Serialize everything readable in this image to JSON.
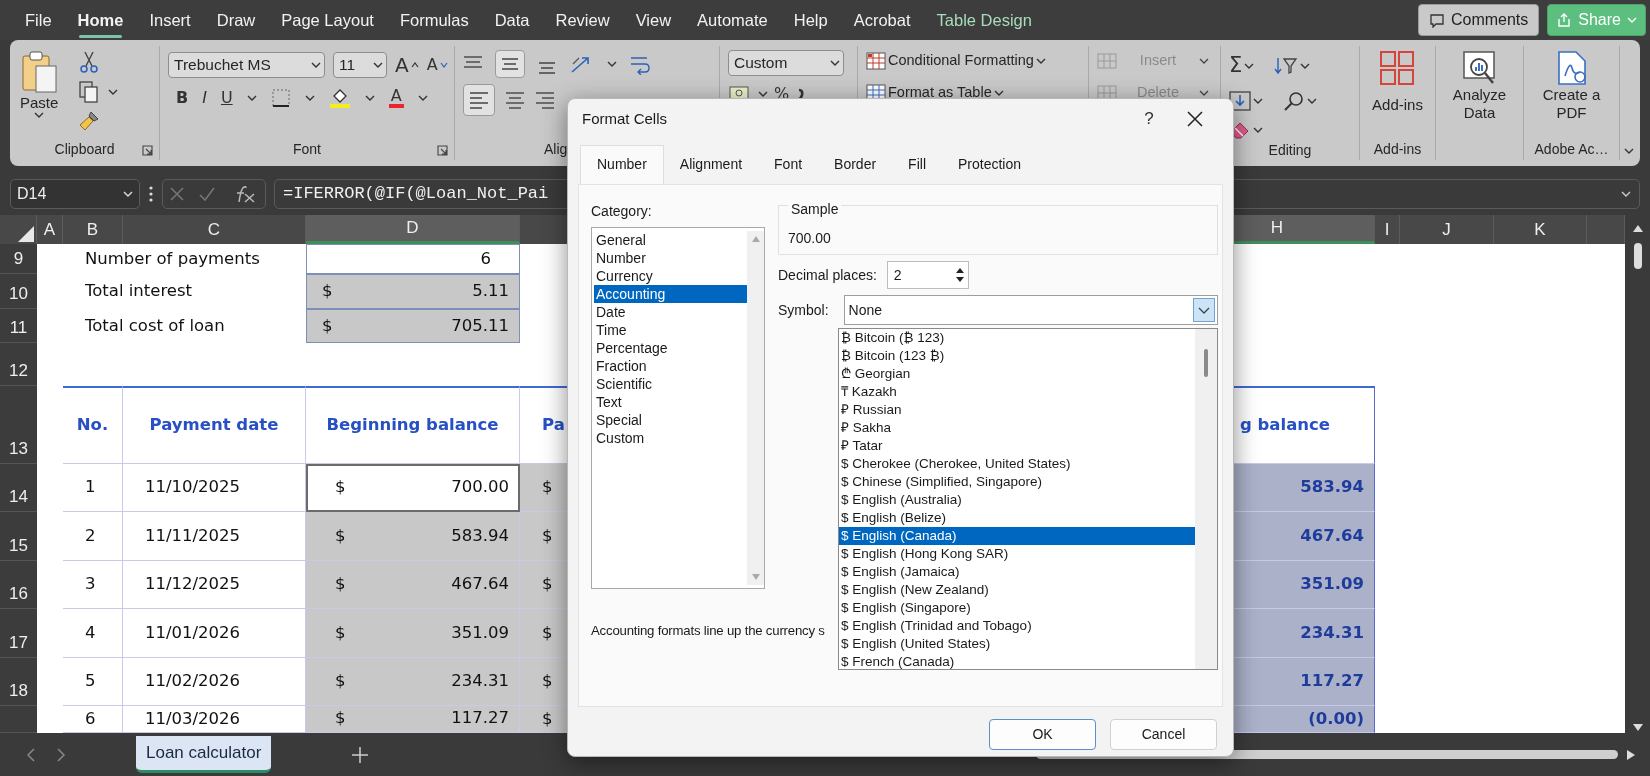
{
  "menu_tabs": [
    {
      "label": "File",
      "selected": false,
      "kind": "standard"
    },
    {
      "label": "Home",
      "selected": true,
      "kind": "standard"
    },
    {
      "label": "Insert",
      "selected": false,
      "kind": "standard"
    },
    {
      "label": "Draw",
      "selected": false,
      "kind": "standard"
    },
    {
      "label": "Page Layout",
      "selected": false,
      "kind": "standard"
    },
    {
      "label": "Formulas",
      "selected": false,
      "kind": "standard"
    },
    {
      "label": "Data",
      "selected": false,
      "kind": "standard"
    },
    {
      "label": "Review",
      "selected": false,
      "kind": "standard"
    },
    {
      "label": "View",
      "selected": false,
      "kind": "standard"
    },
    {
      "label": "Automate",
      "selected": false,
      "kind": "standard"
    },
    {
      "label": "Help",
      "selected": false,
      "kind": "standard"
    },
    {
      "label": "Acrobat",
      "selected": false,
      "kind": "standard"
    },
    {
      "label": "Table Design",
      "selected": false,
      "kind": "contextual"
    }
  ],
  "title_actions": {
    "comments": "Comments",
    "share": "Share"
  },
  "ribbon": {
    "clipboard": {
      "paste": "Paste",
      "label": "Clipboard"
    },
    "font": {
      "font_name": "Trebuchet MS",
      "font_size": "11",
      "grow": "A",
      "shrink": "A",
      "bold": "B",
      "italic": "I",
      "underline": "U",
      "font_color": "A",
      "label": "Font"
    },
    "alignment": {
      "label": "Alig"
    },
    "number": {
      "format": "Custom",
      "percent": "%"
    },
    "styles": {
      "conditional": "Conditional Formatting",
      "format_table": "Format as Table"
    },
    "cells": [
      {
        "label": "Insert",
        "disabled": true
      },
      {
        "label": "Delete",
        "disabled": true
      }
    ],
    "editing": {
      "autosum": "Σ",
      "label": "Editing"
    },
    "addins": {
      "button": "Add-ins",
      "label": "Add-ins"
    },
    "analyze": {
      "button": "Analyze Data"
    },
    "acrobat": {
      "button": "Create a PDF",
      "label": "Adobe Ac…"
    }
  },
  "formula_bar": {
    "name_box": "D14",
    "formula": "=IFERROR(@IF(@Loan_Not_Pai"
  },
  "sheet": {
    "columns": {
      "a": {
        "label": "A",
        "selected": false
      },
      "b": {
        "label": "B",
        "selected": false
      },
      "c": {
        "label": "C",
        "selected": false
      },
      "d": {
        "label": "D",
        "selected": true
      },
      "h": {
        "label": "H",
        "selected": true
      },
      "i": {
        "label": "I",
        "selected": false
      },
      "j": {
        "label": "J",
        "selected": false
      },
      "k": {
        "label": "K",
        "selected": false
      }
    },
    "rows": [
      {
        "header": "9",
        "kind": "summary",
        "b": {
          "text": "Number of payments"
        },
        "d": {
          "value": "6",
          "highlighted": false,
          "selected": false
        }
      },
      {
        "header": "10",
        "kind": "summary",
        "b": {
          "text": "Total interest"
        },
        "d": {
          "symbol": "$",
          "value": "5.11",
          "highlighted": true,
          "selected": false
        }
      },
      {
        "header": "11",
        "kind": "summary",
        "b": {
          "text": "Total cost of loan"
        },
        "d": {
          "symbol": "$",
          "value": "705.11",
          "highlighted": true,
          "selected": false
        }
      },
      {
        "header": "12",
        "kind": "spacer"
      },
      {
        "header": "13",
        "kind": "heading",
        "b": {
          "text": "No."
        },
        "c": {
          "text": "Payment date"
        },
        "d": {
          "text": "Beginning balance",
          "highlighted": false,
          "selected": false
        },
        "e": {
          "text": "Pa"
        },
        "h": {
          "text": "g balance"
        }
      },
      {
        "header": "14",
        "kind": "entry",
        "b": {
          "text": "1"
        },
        "c": {
          "text": "11/10/2025"
        },
        "d": {
          "symbol": "$",
          "value": "700.00",
          "highlighted": false,
          "selected": true
        },
        "e": {
          "symbol": "$",
          "highlighted": true
        },
        "h": {
          "value": "583.94",
          "highlighted": true
        }
      },
      {
        "header": "15",
        "kind": "entry",
        "b": {
          "text": "2"
        },
        "c": {
          "text": "11/11/2025"
        },
        "d": {
          "symbol": "$",
          "value": "583.94",
          "highlighted": true,
          "selected": false
        },
        "e": {
          "symbol": "$",
          "highlighted": true
        },
        "h": {
          "value": "467.64",
          "highlighted": true
        }
      },
      {
        "header": "16",
        "kind": "entry",
        "b": {
          "text": "3"
        },
        "c": {
          "text": "11/12/2025"
        },
        "d": {
          "symbol": "$",
          "value": "467.64",
          "highlighted": true,
          "selected": false
        },
        "e": {
          "symbol": "$",
          "highlighted": true
        },
        "h": {
          "value": "351.09",
          "highlighted": true
        }
      },
      {
        "header": "17",
        "kind": "entry",
        "b": {
          "text": "4"
        },
        "c": {
          "text": "11/01/2026"
        },
        "d": {
          "symbol": "$",
          "value": "351.09",
          "highlighted": true,
          "selected": false
        },
        "e": {
          "symbol": "$",
          "highlighted": true
        },
        "h": {
          "value": "234.31",
          "highlighted": true
        }
      },
      {
        "header": "18",
        "kind": "entry",
        "b": {
          "text": "5"
        },
        "c": {
          "text": "11/02/2026"
        },
        "d": {
          "symbol": "$",
          "value": "234.31",
          "highlighted": true,
          "selected": false
        },
        "e": {
          "symbol": "$",
          "highlighted": true
        },
        "h": {
          "value": "117.27",
          "highlighted": true
        }
      },
      {
        "kind": "entry",
        "b": {
          "text": "6"
        },
        "c": {
          "text": "11/03/2026"
        },
        "d": {
          "symbol": "$",
          "value": "117.27",
          "highlighted": true,
          "selected": false
        },
        "e": {
          "symbol": "$",
          "highlighted": true
        },
        "h": {
          "value": "(0.00)",
          "highlighted": true
        }
      }
    ]
  },
  "sheet_tabs": [
    {
      "label": "Loan calculator",
      "selected": true
    }
  ],
  "dialog": {
    "title": "Format Cells",
    "help": "?",
    "tabs": [
      {
        "label": "Number",
        "selected": true
      },
      {
        "label": "Alignment",
        "selected": false
      },
      {
        "label": "Font",
        "selected": false
      },
      {
        "label": "Border",
        "selected": false
      },
      {
        "label": "Fill",
        "selected": false
      },
      {
        "label": "Protection",
        "selected": false
      }
    ],
    "category_label": "Category:",
    "categories": [
      {
        "label": "General",
        "selected": false
      },
      {
        "label": "Number",
        "selected": false
      },
      {
        "label": "Currency",
        "selected": false
      },
      {
        "label": "Accounting",
        "selected": true
      },
      {
        "label": "Date",
        "selected": false
      },
      {
        "label": "Time",
        "selected": false
      },
      {
        "label": "Percentage",
        "selected": false
      },
      {
        "label": "Fraction",
        "selected": false
      },
      {
        "label": "Scientific",
        "selected": false
      },
      {
        "label": "Text",
        "selected": false
      },
      {
        "label": "Special",
        "selected": false
      },
      {
        "label": "Custom",
        "selected": false
      }
    ],
    "sample_label": "Sample",
    "sample": "700.00",
    "decimal_label": "Decimal places:",
    "decimal_value": "2",
    "symbol_label": "Symbol:",
    "symbol_value": "None",
    "symbol_options": [
      {
        "label": "₿ Bitcoin (₿ 123)",
        "selected": false
      },
      {
        "label": "₿ Bitcoin (123 ₿)",
        "selected": false
      },
      {
        "label": "₾ Georgian",
        "selected": false
      },
      {
        "label": "₸ Kazakh",
        "selected": false
      },
      {
        "label": "₽ Russian",
        "selected": false
      },
      {
        "label": "₽ Sakha",
        "selected": false
      },
      {
        "label": "₽ Tatar",
        "selected": false
      },
      {
        "label": "$ Cherokee (Cherokee, United States)",
        "selected": false
      },
      {
        "label": "$ Chinese (Simplified, Singapore)",
        "selected": false
      },
      {
        "label": "$ English (Australia)",
        "selected": false
      },
      {
        "label": "$ English (Belize)",
        "selected": false
      },
      {
        "label": "$ English (Canada)",
        "selected": true
      },
      {
        "label": "$ English (Hong Kong SAR)",
        "selected": false
      },
      {
        "label": "$ English (Jamaica)",
        "selected": false
      },
      {
        "label": "$ English (New Zealand)",
        "selected": false
      },
      {
        "label": "$ English (Singapore)",
        "selected": false
      },
      {
        "label": "$ English (Trinidad and Tobago)",
        "selected": false
      },
      {
        "label": "$ English (United States)",
        "selected": false
      },
      {
        "label": "$ French (Canada)",
        "selected": false
      }
    ],
    "description": "Accounting formats line up the currency s",
    "buttons": [
      {
        "label": "OK",
        "kind": "default"
      },
      {
        "label": "Cancel",
        "kind": "normal"
      }
    ]
  }
}
